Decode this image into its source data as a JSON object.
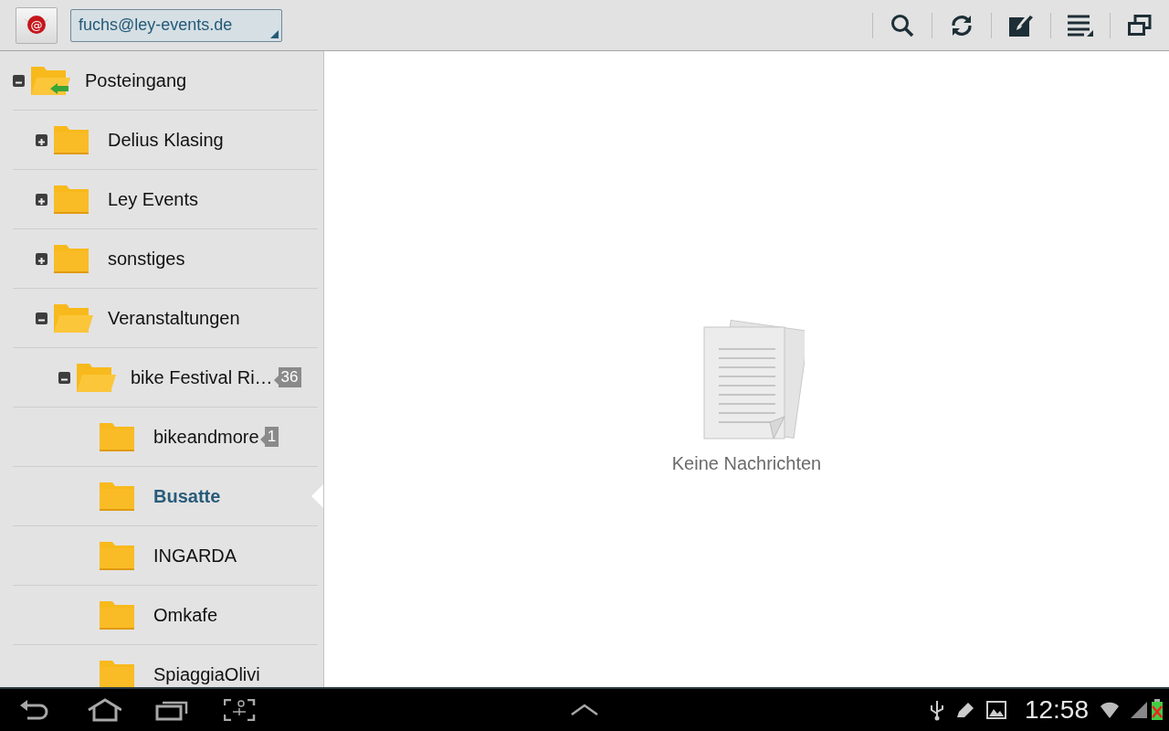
{
  "app_icon": {
    "glyph": "@"
  },
  "account": {
    "value": "fuchs@ley-events.de"
  },
  "folders": [
    {
      "label": "Posteingang",
      "kind": "inbox",
      "expanded": true,
      "selected": false,
      "children": [
        {
          "label": "Delius Klasing",
          "kind": "folder",
          "expanded": false,
          "selected": false
        },
        {
          "label": "Ley Events",
          "kind": "folder",
          "expanded": false,
          "selected": false
        },
        {
          "label": "sonstiges",
          "kind": "folder",
          "expanded": false,
          "selected": false
        },
        {
          "label": "Veranstaltungen",
          "kind": "folder",
          "expanded": true,
          "selected": false,
          "children": [
            {
              "label": "bike Festival Ri…",
              "kind": "folder",
              "expanded": true,
              "selected": false,
              "count": "36",
              "children": [
                {
                  "label": "bikeandmore",
                  "kind": "folder",
                  "selected": false,
                  "count": "1"
                },
                {
                  "label": "Busatte",
                  "kind": "folder",
                  "selected": true
                },
                {
                  "label": "INGARDA",
                  "kind": "folder",
                  "selected": false
                },
                {
                  "label": "Omkafe",
                  "kind": "folder",
                  "selected": false
                },
                {
                  "label": "SpiaggiaOlivi",
                  "kind": "folder",
                  "selected": false
                }
              ]
            }
          ]
        }
      ]
    }
  ],
  "empty_message": "Keine Nachrichten",
  "status_bar": {
    "time": "12:58"
  }
}
